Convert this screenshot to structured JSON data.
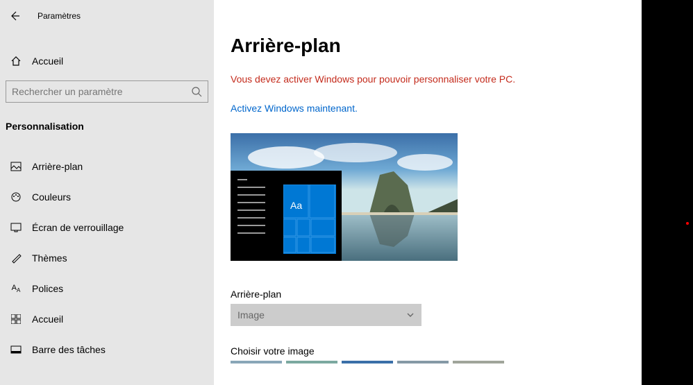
{
  "header": {
    "title": "Paramètres"
  },
  "sidebar": {
    "home_label": "Accueil",
    "search_placeholder": "Rechercher un paramètre",
    "section": "Personnalisation",
    "items": [
      {
        "label": "Arrière-plan"
      },
      {
        "label": "Couleurs"
      },
      {
        "label": "Écran de verrouillage"
      },
      {
        "label": "Thèmes"
      },
      {
        "label": "Polices"
      },
      {
        "label": "Accueil"
      },
      {
        "label": "Barre des tâches"
      }
    ]
  },
  "main": {
    "page_title": "Arrière-plan",
    "warning": "Vous devez activer Windows pour pouvoir personnaliser votre PC.",
    "activate_link": "Activez Windows maintenant.",
    "preview_text": "Aa",
    "bg_label": "Arrière-plan",
    "dropdown_value": "Image",
    "choose_label": "Choisir votre image"
  }
}
